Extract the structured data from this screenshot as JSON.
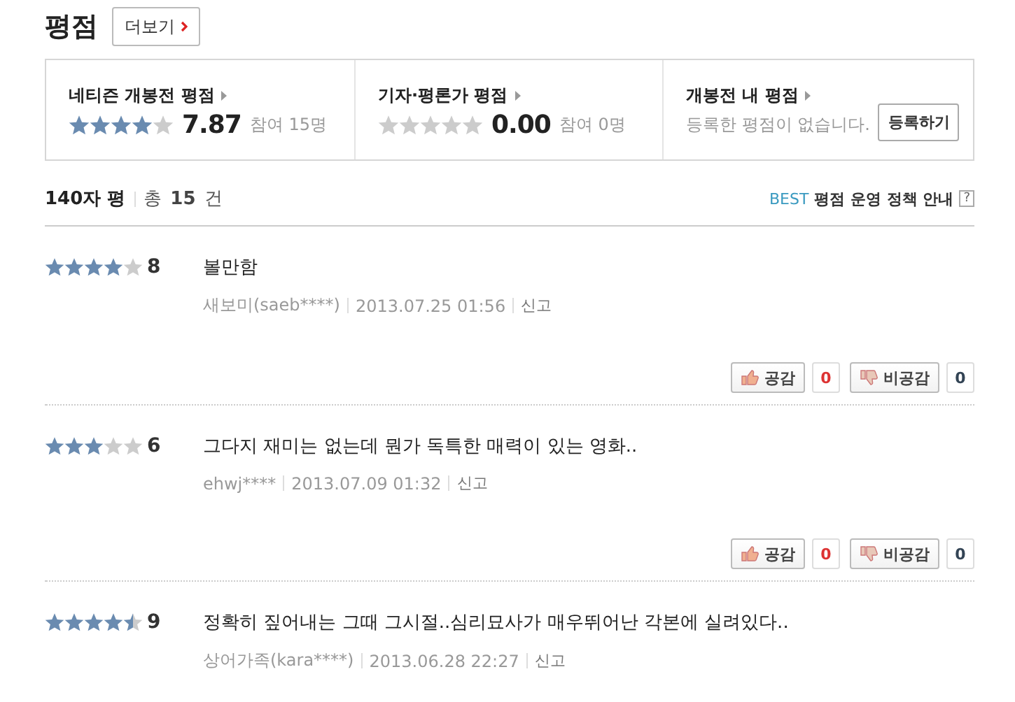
{
  "header": {
    "title": "평점",
    "more_button": "더보기"
  },
  "summary": [
    {
      "kind": "score",
      "title": "네티즌 개봉전 평점",
      "stars": 4,
      "score": "7.87",
      "participants": "참여 15명"
    },
    {
      "kind": "score",
      "title": "기자·평론가 평점",
      "stars": 0,
      "score": "0.00",
      "participants": "참여 0명"
    },
    {
      "kind": "mine",
      "title": "개봉전 내 평점",
      "message": "등록한 평점이 없습니다.",
      "button": "등록하기"
    }
  ],
  "list_header": {
    "label": "140자 평",
    "total_prefix": "총",
    "total_count": "15",
    "total_suffix": "건",
    "policy_badge": "BEST",
    "policy_link": "평점 운영 정책 안내",
    "help": "?"
  },
  "reviews": [
    {
      "stars": 4,
      "score": "8",
      "text": "볼만함",
      "author": "새보미(saeb****)",
      "date": "2013.07.25 01:56",
      "report": "신고",
      "like": "공감",
      "like_count": "0",
      "dislike": "비공감",
      "dislike_count": "0"
    },
    {
      "stars": 3,
      "score": "6",
      "text": "그다지 재미는 없는데 뭔가 독특한 매력이 있는 영화..",
      "author": "ehwj****",
      "date": "2013.07.09 01:32",
      "report": "신고",
      "like": "공감",
      "like_count": "0",
      "dislike": "비공감",
      "dislike_count": "0"
    },
    {
      "stars": 4.5,
      "score": "9",
      "text": "정확히 짚어내는 그때 그시절..심리묘사가 매우뛰어난 각본에 실려있다..",
      "author": "상어가족(kara****)",
      "date": "2013.06.28 22:27",
      "report": "신고"
    }
  ]
}
